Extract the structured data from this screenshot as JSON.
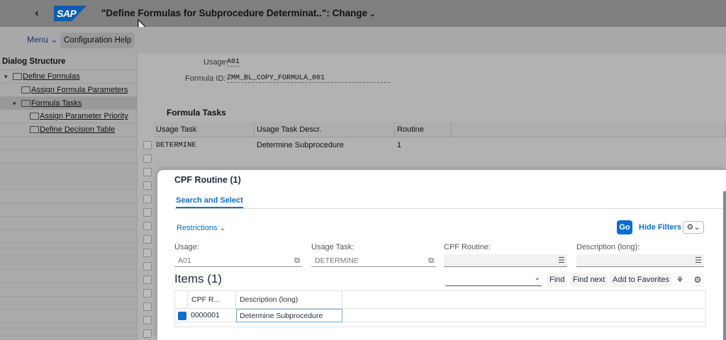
{
  "header": {
    "logo": "SAP",
    "title": "\"Define Formulas for Subprocedure Determinat..\": Change"
  },
  "toolbar": {
    "menu_label": "Menu",
    "config_help_label": "Configuration Help"
  },
  "dialog_structure": {
    "title": "Dialog Structure",
    "items": [
      {
        "label": "Define Formulas",
        "level": 0,
        "expanded": true
      },
      {
        "label": "Assign Formula Parameters",
        "level": 1
      },
      {
        "label": "Formula Tasks",
        "level": 1,
        "expanded": true,
        "selected": true
      },
      {
        "label": "Assign Parameter Priority",
        "level": 2
      },
      {
        "label": "Define Decision Table",
        "level": 2
      }
    ]
  },
  "main": {
    "usage_label": "Usage:",
    "usage_value": "A01",
    "formula_id_label": "Formula ID:",
    "formula_id_value": "ZMM_BL_COPY_FORMULA_001",
    "formula_tasks_title": "Formula Tasks",
    "columns": [
      "Usage Task",
      "Usage Task Descr.",
      "Routine"
    ],
    "rows": [
      {
        "task": "DETERMINE",
        "descr": "Determine Subprocedure",
        "routine": "1"
      }
    ]
  },
  "dialog": {
    "title": "CPF Routine (1)",
    "tab": "Search and Select",
    "restrictions_label": "Restrictions",
    "go_label": "Go",
    "hide_filters_label": "Hide Filters",
    "filters": {
      "usage_label": "Usage:",
      "usage_value": "A01",
      "usage_task_label": "Usage Task:",
      "usage_task_value": "DETERMINE",
      "cpf_routine_label": "CPF Routine:",
      "cpf_routine_value": "",
      "description_label": "Description (long):",
      "description_value": ""
    },
    "items_title": "Items (1)",
    "find_label": "Find",
    "find_next_label": "Find next",
    "add_fav_label": "Add to Favorites",
    "table": {
      "columns": [
        "CPF R...",
        "Description (long)"
      ],
      "rows": [
        {
          "routine": "0000001",
          "description": "Determine Subprocedure"
        }
      ]
    }
  },
  "icons": [
    "back-icon",
    "chevron-down-icon",
    "folder-icon",
    "value-help-icon",
    "settings-icon",
    "personalize-icon",
    "cursor-icon"
  ]
}
